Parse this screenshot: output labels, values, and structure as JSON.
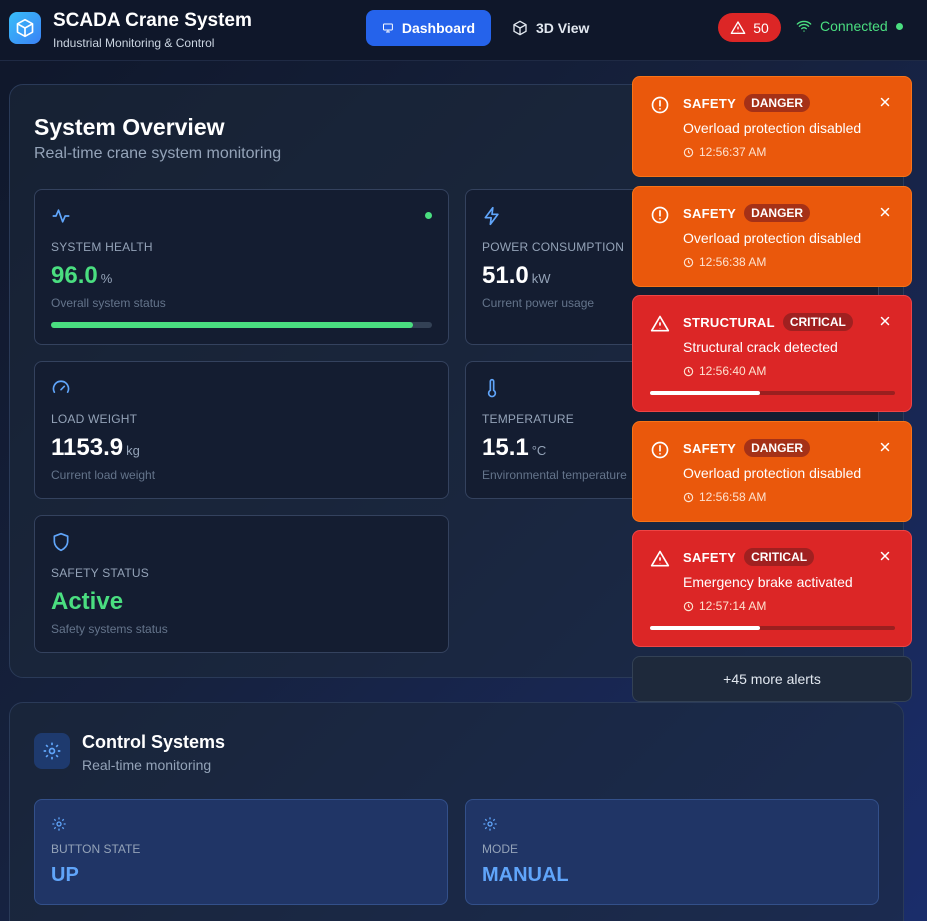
{
  "header": {
    "title": "SCADA Crane System",
    "subtitle": "Industrial Monitoring & Control",
    "nav": [
      {
        "label": "Dashboard",
        "icon": "monitor-icon",
        "active": true
      },
      {
        "label": "3D View",
        "icon": "cube-icon",
        "active": false
      }
    ],
    "alert_count": "50",
    "connection_status": "Connected"
  },
  "overview": {
    "title": "System Overview",
    "subtitle": "Real-time crane system monitoring",
    "cards": {
      "health": {
        "label": "SYSTEM HEALTH",
        "value": "96.0",
        "unit": "%",
        "desc": "Overall system status",
        "progress": 0.95
      },
      "power": {
        "label": "POWER CONSUMPTION",
        "value": "51.0",
        "unit": "kW",
        "desc": "Current power usage"
      },
      "load": {
        "label": "LOAD WEIGHT",
        "value": "1153.9",
        "unit": "kg",
        "desc": "Current load weight"
      },
      "temperature": {
        "label": "TEMPERATURE",
        "value": "15.1",
        "unit": "°C",
        "desc": "Environmental temperature"
      },
      "safety": {
        "label": "SAFETY STATUS",
        "value": "Active",
        "desc": "Safety systems status"
      }
    }
  },
  "control": {
    "title": "Control Systems",
    "subtitle": "Real-time monitoring",
    "cards": [
      {
        "label": "BUTTON STATE",
        "value": "UP"
      },
      {
        "label": "MODE",
        "value": "MANUAL"
      }
    ]
  },
  "alerts": [
    {
      "category": "SAFETY",
      "severity": "DANGER",
      "message": "Overload protection disabled",
      "time": "12:56:37 AM",
      "progress": null
    },
    {
      "category": "SAFETY",
      "severity": "DANGER",
      "message": "Overload protection disabled",
      "time": "12:56:38 AM",
      "progress": null
    },
    {
      "category": "STRUCTURAL",
      "severity": "CRITICAL",
      "message": "Structural crack detected",
      "time": "12:56:40 AM",
      "progress": 0.45
    },
    {
      "category": "SAFETY",
      "severity": "DANGER",
      "message": "Overload protection disabled",
      "time": "12:56:58 AM",
      "progress": null
    },
    {
      "category": "SAFETY",
      "severity": "CRITICAL",
      "message": "Emergency brake activated",
      "time": "12:57:14 AM",
      "progress": 0.45
    }
  ],
  "more_alerts_label": "+45 more alerts",
  "colors": {
    "accent": "#2563eb",
    "ok": "#4ade80",
    "danger": "#ea580c",
    "critical": "#dc2626",
    "value_blue": "#60a5fa"
  }
}
